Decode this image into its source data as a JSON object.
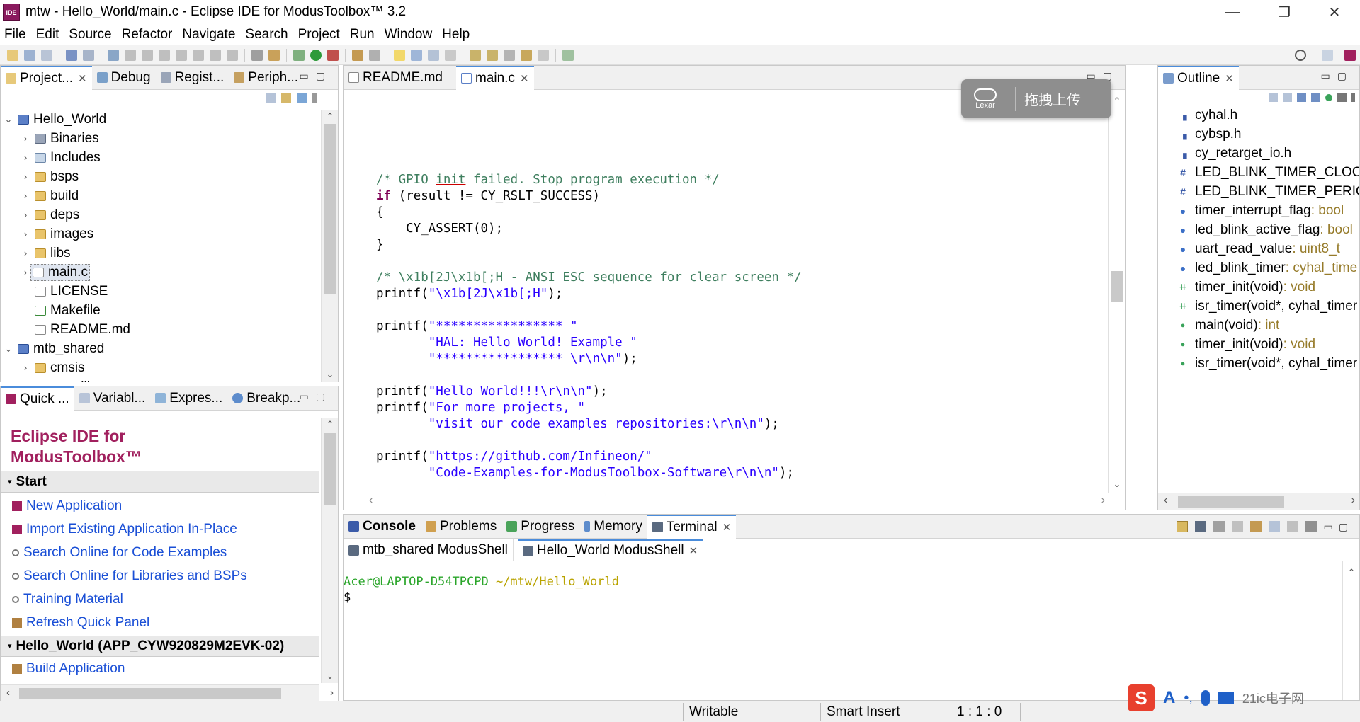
{
  "window": {
    "title": "mtw - Hello_World/main.c - Eclipse IDE for ModusToolbox™ 3.2",
    "app_icon": "IDE",
    "controls": {
      "minimize": "—",
      "maximize": "❐",
      "close": "✕"
    }
  },
  "menu": [
    "File",
    "Edit",
    "Source",
    "Refactor",
    "Navigate",
    "Search",
    "Project",
    "Run",
    "Window",
    "Help"
  ],
  "project_panel": {
    "tabs": [
      "Project...",
      "Debug",
      "Regist...",
      "Periph..."
    ],
    "tree": [
      {
        "label": "Hello_World",
        "level": 0,
        "icon": "project-icon",
        "expanded": true
      },
      {
        "label": "Binaries",
        "level": 1,
        "icon": "binaries-icon"
      },
      {
        "label": "Includes",
        "level": 1,
        "icon": "includes-icon"
      },
      {
        "label": "bsps",
        "level": 1,
        "icon": "folder-icon"
      },
      {
        "label": "build",
        "level": 1,
        "icon": "folder-icon"
      },
      {
        "label": "deps",
        "level": 1,
        "icon": "folder-icon"
      },
      {
        "label": "images",
        "level": 1,
        "icon": "folder-icon"
      },
      {
        "label": "libs",
        "level": 1,
        "icon": "folder-icon"
      },
      {
        "label": "main.c",
        "level": 1,
        "icon": "c-file-icon",
        "selected": true
      },
      {
        "label": "LICENSE",
        "level": 1,
        "icon": "file-icon"
      },
      {
        "label": "Makefile",
        "level": 1,
        "icon": "makefile-icon"
      },
      {
        "label": "README.md",
        "level": 1,
        "icon": "file-icon"
      },
      {
        "label": "mtb_shared",
        "level": 0,
        "icon": "project-icon",
        "expanded": true
      },
      {
        "label": "cmsis",
        "level": 1,
        "icon": "folder-icon"
      },
      {
        "label": "core-lib",
        "level": 1,
        "icon": "folder-icon"
      }
    ]
  },
  "quick_panel": {
    "tabs": [
      "Quick ...",
      "Variabl...",
      "Expres...",
      "Breakp..."
    ],
    "title_line1": "Eclipse IDE for",
    "title_line2": "ModusToolbox™",
    "start_section": "Start",
    "start_links": [
      "New Application",
      "Import Existing Application In-Place",
      "Search Online for Code Examples",
      "Search Online for Libraries and BSPs",
      "Training Material",
      "Refresh Quick Panel"
    ],
    "app_section": "Hello_World (APP_CYW920829M2EVK-02)",
    "app_links": [
      "Build Application"
    ]
  },
  "editor": {
    "tabs": [
      "README.md",
      "main.c"
    ],
    "active_tab": "main.c"
  },
  "upload_overlay": {
    "brand": "Lexar",
    "label": "拖拽上传"
  },
  "outline": {
    "tab": "Outline",
    "items": [
      {
        "name": "cyhal.h",
        "type": "",
        "icon": "include-icon"
      },
      {
        "name": "cybsp.h",
        "type": "",
        "icon": "include-icon"
      },
      {
        "name": "cy_retarget_io.h",
        "type": "",
        "icon": "include-icon"
      },
      {
        "name": "LED_BLINK_TIMER_CLOCK_",
        "type": "",
        "icon": "macro-icon"
      },
      {
        "name": "LED_BLINK_TIMER_PERIOD",
        "type": "",
        "icon": "macro-icon"
      },
      {
        "name": "timer_interrupt_flag",
        "type": " : bool",
        "icon": "variable-icon"
      },
      {
        "name": "led_blink_active_flag",
        "type": " : bool",
        "icon": "variable-icon"
      },
      {
        "name": "uart_read_value",
        "type": " : uint8_t",
        "icon": "variable-icon"
      },
      {
        "name": "led_blink_timer",
        "type": " : cyhal_time",
        "icon": "variable-icon"
      },
      {
        "name": "timer_init(void)",
        "type": " : void",
        "icon": "function-declaration-icon"
      },
      {
        "name": "isr_timer(void*, cyhal_timer",
        "type": "",
        "icon": "static-function-declaration-icon"
      },
      {
        "name": "main(void)",
        "type": " : int",
        "icon": "function-icon"
      },
      {
        "name": "timer_init(void)",
        "type": " : void",
        "icon": "function-icon"
      },
      {
        "name": "isr_timer(void*, cyhal_timer",
        "type": "",
        "icon": "static-function-icon"
      }
    ]
  },
  "console_panel": {
    "tabs": [
      "Console",
      "Problems",
      "Progress",
      "Memory",
      "Terminal"
    ],
    "active_tab": "Terminal",
    "terminal_tabs": [
      "mtb_shared ModusShell",
      "Hello_World ModusShell"
    ],
    "active_terminal": "Hello_World ModusShell",
    "prompt_user": "Acer@LAPTOP-D54TPCPD",
    "prompt_path": "~/mtw/Hello_World",
    "prompt_symbol": "$"
  },
  "status_bar": {
    "mode": "Writable",
    "insert_mode": "Smart Insert",
    "position": "1 : 1 : 0"
  },
  "watermark": "21ic电子网",
  "colors": {
    "comment": "#3f7f5f",
    "keyword": "#7f0055",
    "string": "#2a00ff",
    "quick_title": "#a1205e",
    "link": "#1a4fd6",
    "prompt_user": "#2aa52a",
    "prompt_path": "#b9a300"
  }
}
